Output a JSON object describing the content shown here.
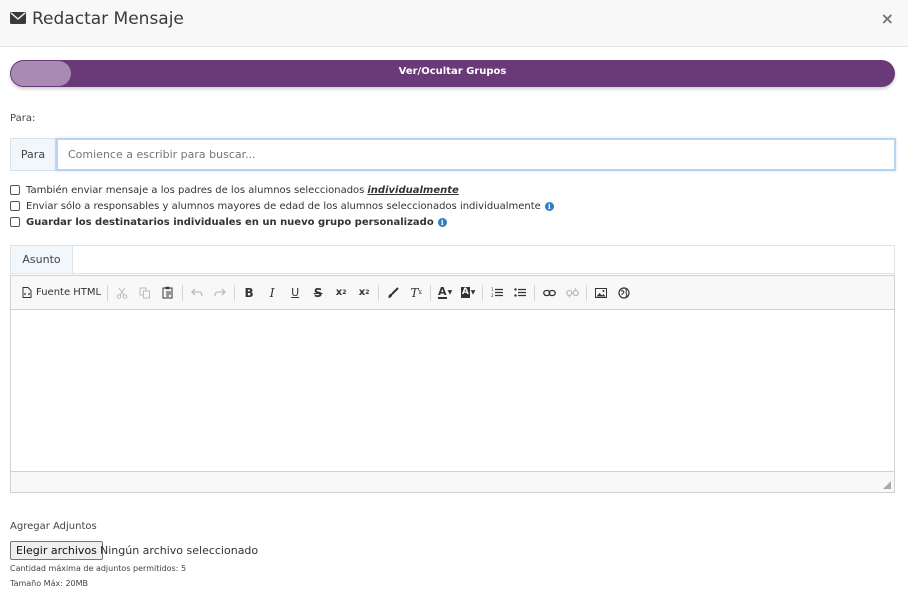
{
  "header": {
    "title": "Redactar Mensaje",
    "title_icon": "envelope-icon",
    "close_label": "×"
  },
  "toggle": {
    "label": "Ver/Ocultar Grupos",
    "color": "#6a3a78"
  },
  "recipients": {
    "section_label": "Para:",
    "addon": "Para",
    "placeholder": "Comience a escribir para buscar..."
  },
  "options": [
    {
      "text": "También enviar mensaje a los padres de los alumnos seleccionados",
      "emphasis": "individualmente",
      "checked": false
    },
    {
      "text": "Enviar sólo a responsables y alumnos mayores de edad de los alumnos seleccionados individualmente",
      "info": "i",
      "checked": false
    },
    {
      "text": "Guardar los destinatarios individuales en un nuevo grupo personalizado",
      "info": "i",
      "checked": false
    }
  ],
  "subject": {
    "addon": "Asunto",
    "value": ""
  },
  "editor": {
    "source_label": "Fuente HTML",
    "toolbar_icons": [
      "source-icon",
      "cut-icon",
      "copy-icon",
      "paste-icon",
      "undo-icon",
      "redo-icon",
      "bold-icon",
      "italic-icon",
      "underline-icon",
      "strike-icon",
      "subscript-icon",
      "superscript-icon",
      "format-brush-icon",
      "clear-format-icon",
      "text-color-icon",
      "bg-color-icon",
      "numbered-list-icon",
      "bullet-list-icon",
      "link-icon",
      "unlink-icon",
      "image-icon",
      "globe-icon"
    ]
  },
  "attachments": {
    "title": "Agregar Adjuntos",
    "button_label": "Elegir archivos",
    "no_file": "Ningún archivo seleccionado",
    "max_count": "Cantidad máxima de adjuntos permitidos: 5",
    "max_size": "Tamaño Máx: 20MB"
  }
}
